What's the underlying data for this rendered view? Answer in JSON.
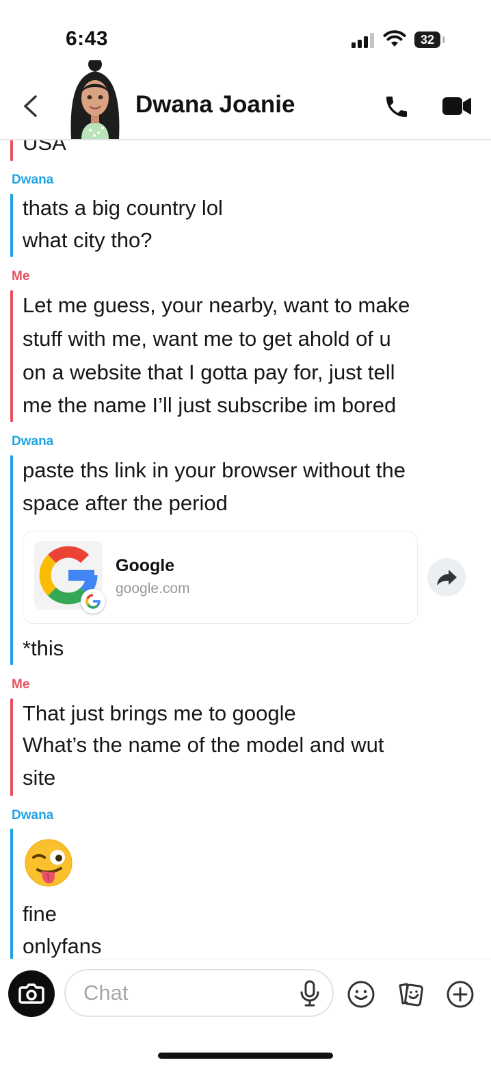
{
  "status_bar": {
    "time": "6:43",
    "battery": "32"
  },
  "header": {
    "contact_name": "Dwana Joanie"
  },
  "messages": [
    {
      "sender": "",
      "side": "me",
      "lines": [
        "USA"
      ]
    },
    {
      "sender": "Dwana",
      "side": "them",
      "lines": [
        "thats a big country lol",
        "what city tho?"
      ]
    },
    {
      "sender": "Me",
      "side": "me",
      "lines": [
        "Let me guess, your nearby, want to make",
        "stuff with me, want me to get ahold of u",
        "on a website that I gotta pay for, just tell",
        "me the name I’ll just subscribe im bored"
      ]
    },
    {
      "sender": "Dwana",
      "side": "them",
      "lines": [
        "paste ths link in your browser without the",
        "space after the period",
        "*this"
      ]
    },
    {
      "sender": "Me",
      "side": "me",
      "lines": [
        "That just brings me to google",
        "What’s the name of the model and wut",
        "site"
      ]
    },
    {
      "sender": "Dwana",
      "side": "them",
      "lines": [
        "fine",
        "onlyfans"
      ]
    }
  ],
  "link_preview": {
    "title": "Google",
    "url": "google.com"
  },
  "input": {
    "placeholder": "Chat"
  },
  "colors": {
    "them": "#1ea3e3",
    "me": "#e8505b"
  },
  "icons": [
    "back-chevron-icon",
    "phone-icon",
    "video-camera-icon",
    "camera-icon",
    "microphone-icon",
    "emoji-icon",
    "sticker-icon",
    "plus-icon",
    "share-arrow-icon",
    "google-logo-icon",
    "winking-tongue-emoji"
  ]
}
